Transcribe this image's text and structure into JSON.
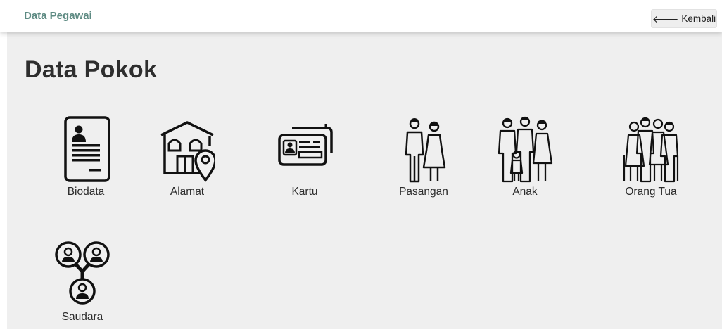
{
  "header": {
    "title": "Data Pegawai",
    "back_label": "Kembali"
  },
  "page": {
    "title": "Data Pokok"
  },
  "menu": [
    {
      "label": "Biodata",
      "icon": "biodata-document-icon"
    },
    {
      "label": "Alamat",
      "icon": "house-location-icon"
    },
    {
      "label": "Kartu",
      "icon": "id-card-icon"
    },
    {
      "label": "Pasangan",
      "icon": "couple-icon"
    },
    {
      "label": "Anak",
      "icon": "family-with-child-icon"
    },
    {
      "label": "Orang Tua",
      "icon": "elderly-parents-icon"
    },
    {
      "label": "Saudara",
      "icon": "siblings-network-icon"
    }
  ],
  "colors": {
    "brand": "#5d8a82",
    "content_bg": "#efefef",
    "icon": "#111111"
  }
}
